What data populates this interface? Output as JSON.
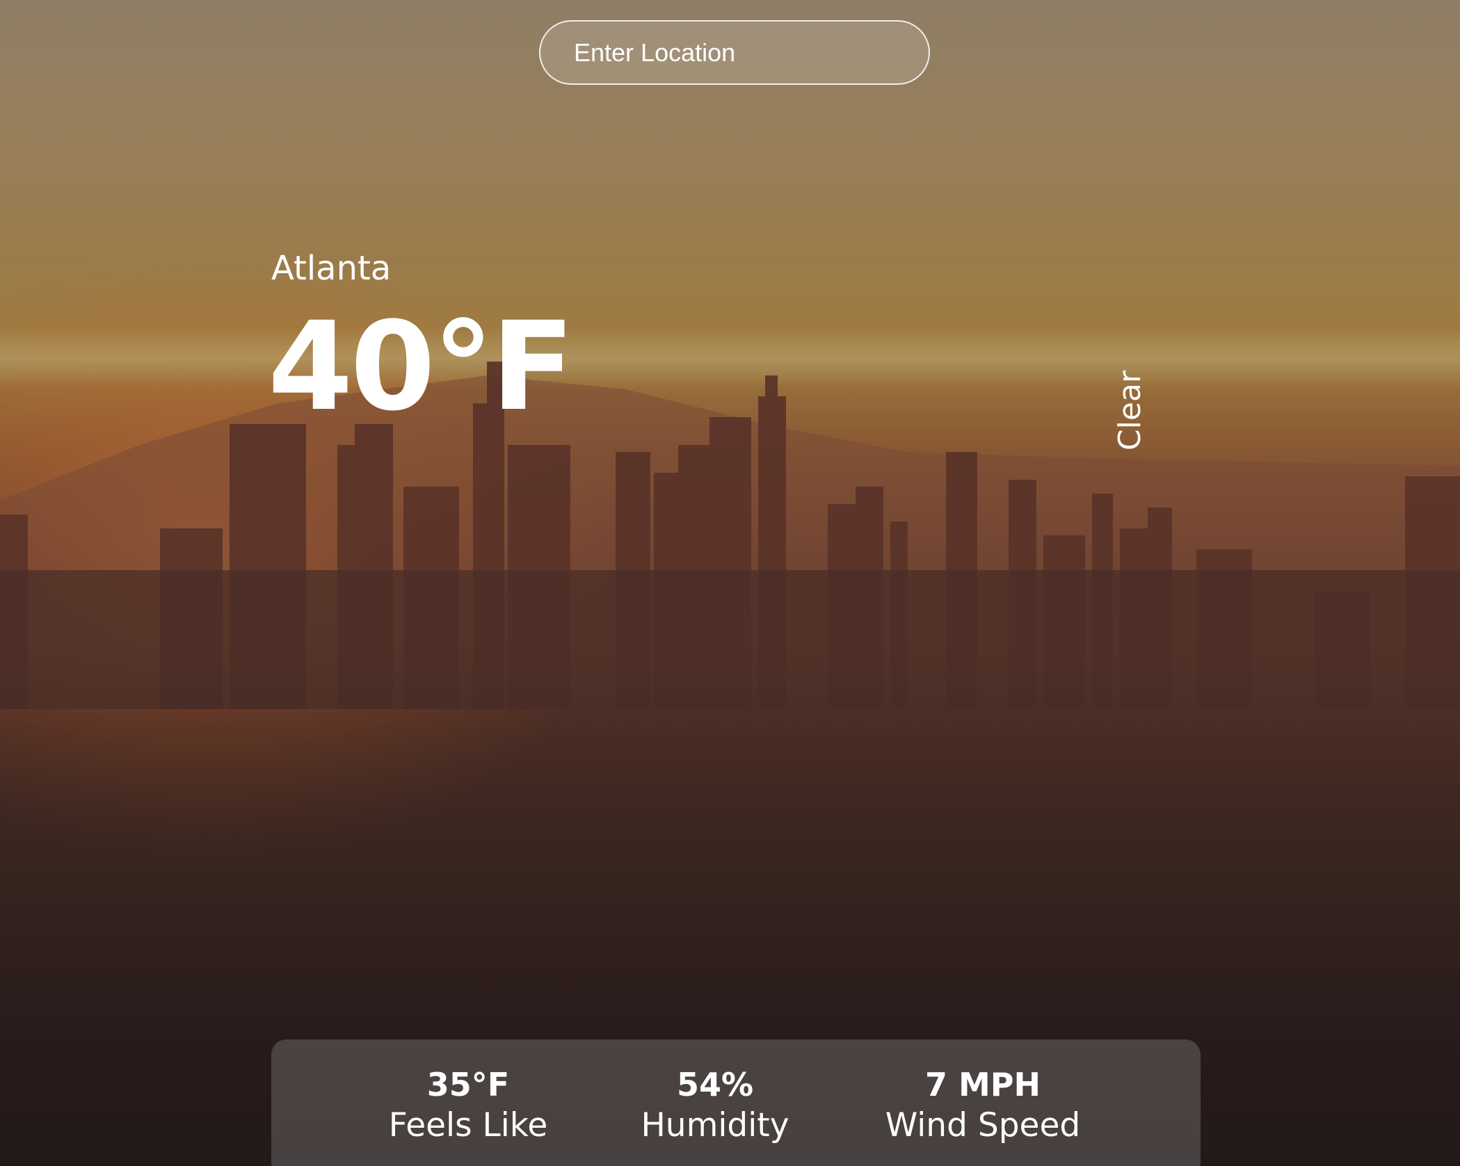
{
  "search": {
    "placeholder": "Enter Location",
    "value": ""
  },
  "weather": {
    "location": "Atlanta",
    "temperature": "40°F",
    "condition": "Clear"
  },
  "stats": {
    "feels_like": {
      "value": "35°F",
      "label": "Feels Like"
    },
    "humidity": {
      "value": "54%",
      "label": "Humidity"
    },
    "wind_speed": {
      "value": "7 MPH",
      "label": "Wind Speed"
    }
  },
  "colors": {
    "text": "#ffffff",
    "panel": "rgba(150,150,150,0.32)",
    "sky": "#9a7c4c",
    "city": "#3f2a24"
  },
  "background": {
    "depicts": "city skyline at sunset"
  }
}
